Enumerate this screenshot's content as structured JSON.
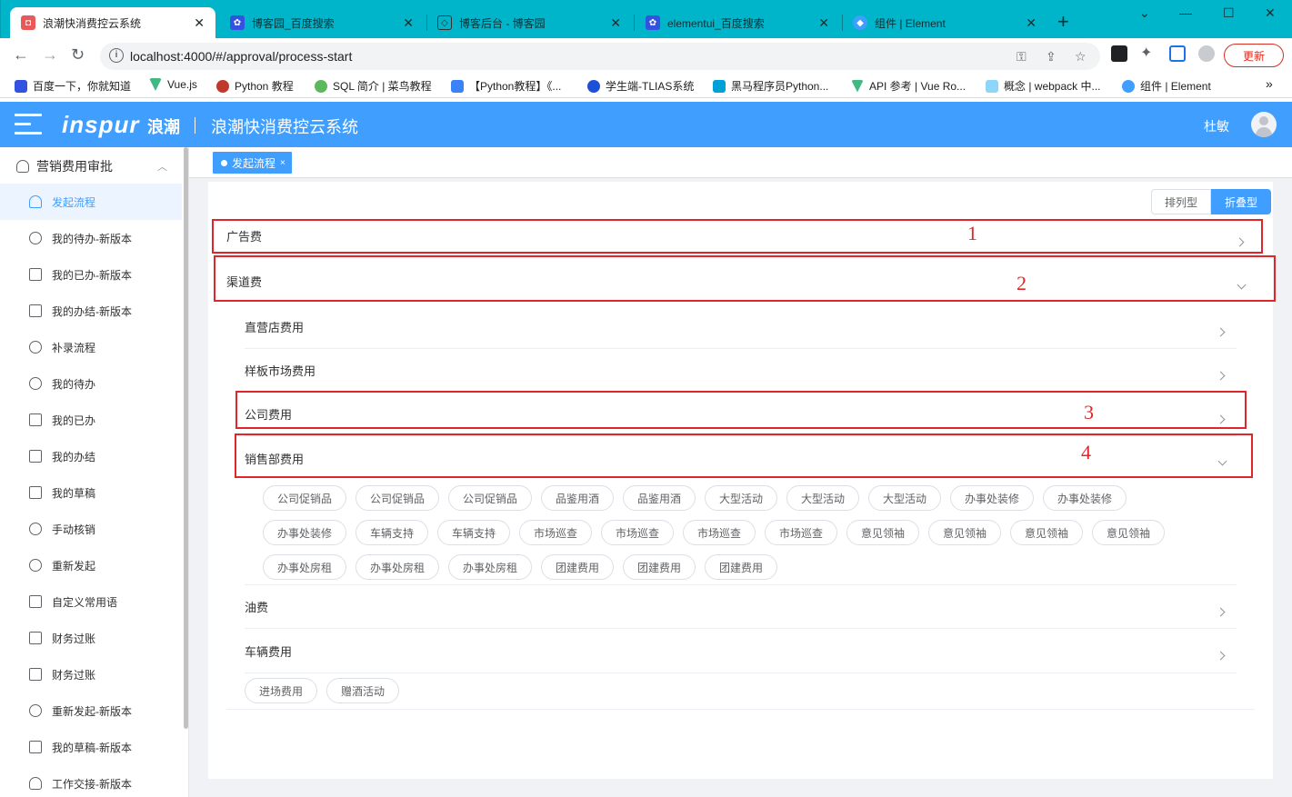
{
  "browser": {
    "tabs": [
      {
        "title": "浪潮快消费控云系统",
        "active": true,
        "favicon_color": "#e85a5a"
      },
      {
        "title": "博客园_百度搜索",
        "active": false,
        "favicon_color": "#3352e0"
      },
      {
        "title": "博客后台 - 博客园",
        "active": false,
        "favicon_color": "#5a5a5a"
      },
      {
        "title": "elementui_百度搜索",
        "active": false,
        "favicon_color": "#3352e0"
      },
      {
        "title": "组件 | Element",
        "active": false,
        "favicon_color": "#409eff"
      }
    ],
    "new_tab_label": "+",
    "url": "localhost:4000/#/approval/process-start",
    "update_label": "更新",
    "bookmarks": [
      {
        "label": "百度一下，你就知道",
        "color": "#3352e0"
      },
      {
        "label": "Vue.js",
        "color": "#42b883"
      },
      {
        "label": "Python 教程",
        "color": "#c0392b"
      },
      {
        "label": "SQL 简介 | 菜鸟教程",
        "color": "#5cb85c"
      },
      {
        "label": "【Python教程】《...",
        "color": "#3b82f6"
      },
      {
        "label": "学生端-TLIAS系统",
        "color": "#1e4fd8"
      },
      {
        "label": "黑马程序员Python...",
        "color": "#00a1d6"
      },
      {
        "label": "API 参考 | Vue Ro...",
        "color": "#42b883"
      },
      {
        "label": "概念 | webpack 中...",
        "color": "#8dd6f9"
      },
      {
        "label": "组件 | Element",
        "color": "#409eff"
      }
    ],
    "bookmarks_more": "»"
  },
  "header": {
    "logo": "inspur",
    "logo_cn": "浪潮",
    "separator": "|",
    "title": "浪潮快消费控云系统",
    "username": "杜敏"
  },
  "sidebar": {
    "group_title": "营销费用审批",
    "items": [
      {
        "label": "发起流程",
        "active": true
      },
      {
        "label": "我的待办-新版本"
      },
      {
        "label": "我的已办-新版本"
      },
      {
        "label": "我的办结-新版本"
      },
      {
        "label": "补录流程"
      },
      {
        "label": "我的待办"
      },
      {
        "label": "我的已办"
      },
      {
        "label": "我的办结"
      },
      {
        "label": "我的草稿"
      },
      {
        "label": "手动核销"
      },
      {
        "label": "重新发起"
      },
      {
        "label": "自定义常用语"
      },
      {
        "label": "财务过账"
      },
      {
        "label": "财务过账"
      },
      {
        "label": "重新发起-新版本"
      },
      {
        "label": "我的草稿-新版本"
      },
      {
        "label": "工作交接-新版本"
      }
    ]
  },
  "tagsview": {
    "active_tag": "发起流程",
    "close": "×"
  },
  "view_switch": {
    "list_label": "排列型",
    "fold_label": "折叠型",
    "selected": "折叠型"
  },
  "categories": {
    "ad": {
      "label": "广告费",
      "expanded": false
    },
    "channel": {
      "label": "渠道费",
      "expanded": true,
      "children": {
        "direct_store": {
          "label": "直营店费用",
          "expanded": false
        },
        "sample_market": {
          "label": "样板市场费用",
          "expanded": false
        },
        "company": {
          "label": "公司费用",
          "expanded": false
        },
        "sales_dept": {
          "label": "销售部费用",
          "expanded": true,
          "chips": [
            "公司促销品",
            "公司促销品",
            "公司促销品",
            "品鉴用酒",
            "品鉴用酒",
            "大型活动",
            "大型活动",
            "大型活动",
            "办事处装修",
            "办事处装修",
            "办事处装修",
            "车辆支持",
            "车辆支持",
            "市场巡查",
            "市场巡查",
            "市场巡查",
            "市场巡查",
            "意见领袖",
            "意见领袖",
            "意见领袖",
            "意见领袖",
            "办事处房租",
            "办事处房租",
            "办事处房租",
            "团建费用",
            "团建费用",
            "团建费用"
          ]
        },
        "oil": {
          "label": "油费",
          "expanded": false
        },
        "vehicle": {
          "label": "车辆费用",
          "expanded": true,
          "chips": [
            "进场费用",
            "赠酒活动"
          ]
        }
      }
    }
  },
  "annotations": [
    "1",
    "2",
    "3",
    "4"
  ],
  "colors": {
    "primary": "#409eff",
    "annotation": "#e0262b",
    "chrome": "#00b4c9"
  }
}
